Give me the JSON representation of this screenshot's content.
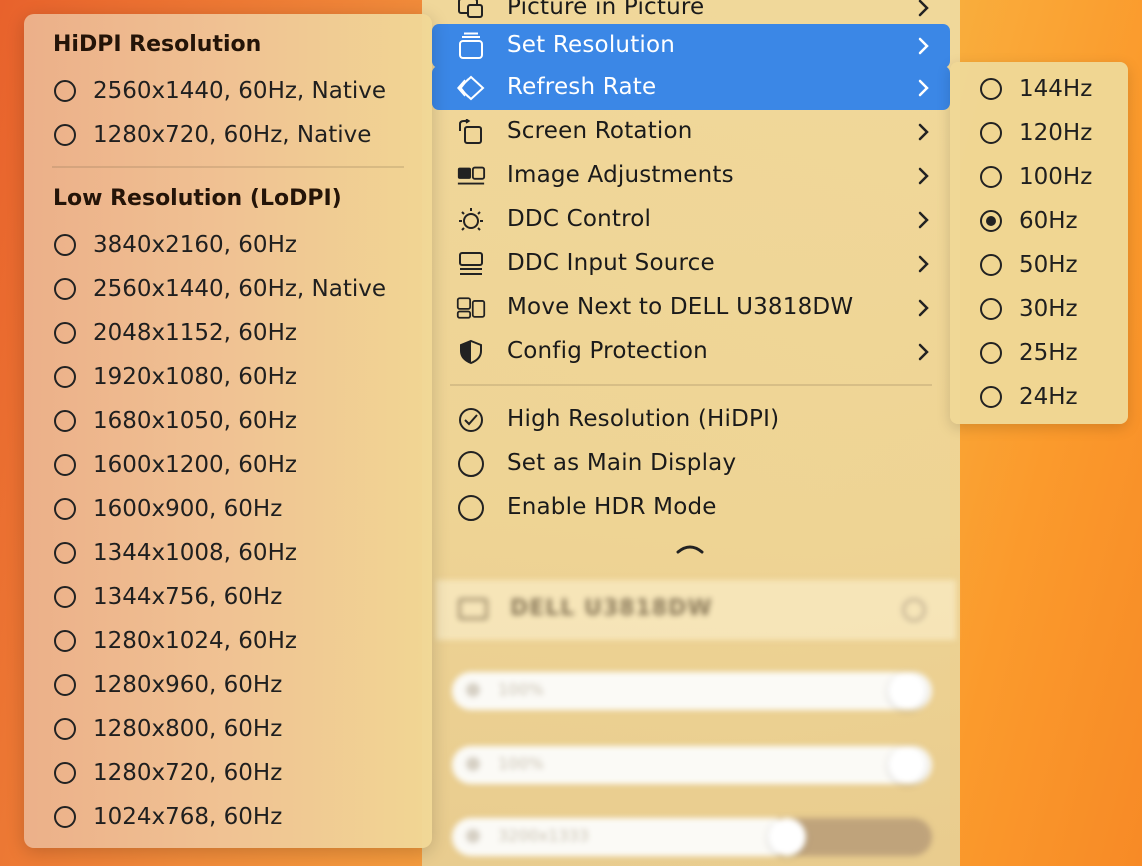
{
  "main_menu": {
    "items": [
      {
        "label": "Picture in Picture",
        "icon": "pip-icon",
        "submenu": true,
        "highlighted": false
      },
      {
        "label": "Set Resolution",
        "icon": "resolution-icon",
        "submenu": true,
        "highlighted": true
      },
      {
        "label": "Refresh Rate",
        "icon": "refresh-rate-icon",
        "submenu": true,
        "highlighted": true
      },
      {
        "label": "Screen Rotation",
        "icon": "rotation-icon",
        "submenu": true,
        "highlighted": false
      },
      {
        "label": "Image Adjustments",
        "icon": "image-adjust-icon",
        "submenu": true,
        "highlighted": false
      },
      {
        "label": "DDC Control",
        "icon": "brightness-icon",
        "submenu": true,
        "highlighted": false
      },
      {
        "label": "DDC Input Source",
        "icon": "input-source-icon",
        "submenu": true,
        "highlighted": false
      },
      {
        "label": "Move Next to DELL U3818DW",
        "icon": "arrange-displays-icon",
        "submenu": true,
        "highlighted": false
      },
      {
        "label": "Config Protection",
        "icon": "shield-icon",
        "submenu": true,
        "highlighted": false
      }
    ],
    "toggles": [
      {
        "label": "High Resolution (HiDPI)",
        "checked": true
      },
      {
        "label": "Set as Main Display",
        "checked": false
      },
      {
        "label": "Enable HDR Mode",
        "checked": false
      }
    ],
    "highlight_color": "#3b87e6"
  },
  "resolution_menu": {
    "hidpi_header": "HiDPI Resolution",
    "hidpi_items": [
      "2560x1440, 60Hz, Native",
      "1280x720, 60Hz, Native"
    ],
    "lodpi_header": "Low Resolution (LoDPI)",
    "lodpi_items": [
      "3840x2160, 60Hz",
      "2560x1440, 60Hz, Native",
      "2048x1152, 60Hz",
      "1920x1080, 60Hz",
      "1680x1050, 60Hz",
      "1600x1200, 60Hz",
      "1600x900, 60Hz",
      "1344x1008, 60Hz",
      "1344x756, 60Hz",
      "1280x1024, 60Hz",
      "1280x960, 60Hz",
      "1280x800, 60Hz",
      "1280x720, 60Hz",
      "1024x768, 60Hz"
    ]
  },
  "refresh_menu": {
    "items": [
      "144Hz",
      "120Hz",
      "100Hz",
      "60Hz",
      "50Hz",
      "30Hz",
      "25Hz",
      "24Hz"
    ],
    "selected": "60Hz"
  },
  "display_panel": {
    "display_name": "DELL U3818DW",
    "brightness": "100%",
    "volume": "100%",
    "resolution": "3200x1333"
  }
}
